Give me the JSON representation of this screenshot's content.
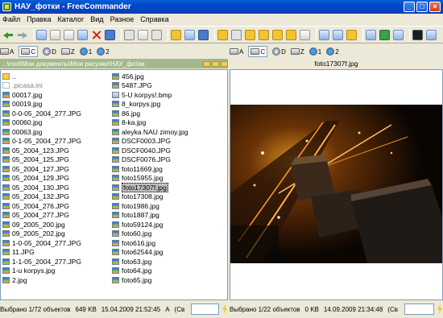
{
  "window": {
    "title": "НАУ_фотки - FreeCommander",
    "controls": [
      "_",
      "□",
      "×"
    ]
  },
  "menu": [
    "Файл",
    "Правка",
    "Каталог",
    "Вид",
    "Разное",
    "Справка"
  ],
  "drives_left": [
    {
      "label": "A",
      "type": "floppy"
    },
    {
      "label": "C",
      "type": "disk",
      "selected": true
    },
    {
      "label": "D",
      "type": "cd"
    },
    {
      "label": "Z",
      "type": "disk"
    },
    {
      "label": "1",
      "type": "net"
    },
    {
      "label": "2",
      "type": "net"
    }
  ],
  "drives_right": [
    {
      "label": "A",
      "type": "floppy"
    },
    {
      "label": "C",
      "type": "disk",
      "selected": true
    },
    {
      "label": "D",
      "type": "cd"
    },
    {
      "label": "Z",
      "type": "disk"
    },
    {
      "label": "1",
      "type": "net"
    },
    {
      "label": "2",
      "type": "net"
    }
  ],
  "left_path": "...\\root\\Мои документы\\Мои рисунки\\НАУ_фотки",
  "right_header": "foto17307f.jpg",
  "files_col1": [
    {
      "name": "..",
      "icon": "updir"
    },
    {
      "name": ".picasa.ini",
      "icon": "ini",
      "gray": true
    },
    {
      "name": "00017.jpg",
      "icon": "jpg"
    },
    {
      "name": "00019.jpg",
      "icon": "jpg"
    },
    {
      "name": "0-0-05_2004_277.JPG",
      "icon": "jpg"
    },
    {
      "name": "00060.jpg",
      "icon": "jpg"
    },
    {
      "name": "00063.jpg",
      "icon": "jpg"
    },
    {
      "name": "0-1-05_2004_277.JPG",
      "icon": "jpg"
    },
    {
      "name": "05_2004_123.JPG",
      "icon": "jpg"
    },
    {
      "name": "05_2004_125.JPG",
      "icon": "jpg"
    },
    {
      "name": "05_2004_127.JPG",
      "icon": "jpg"
    },
    {
      "name": "05_2004_129.JPG",
      "icon": "jpg"
    },
    {
      "name": "05_2004_130.JPG",
      "icon": "jpg"
    },
    {
      "name": "05_2004_132.JPG",
      "icon": "jpg"
    },
    {
      "name": "05_2004_276.JPG",
      "icon": "jpg"
    },
    {
      "name": "05_2004_277.JPG",
      "icon": "jpg"
    },
    {
      "name": "09_2005_200.jpg",
      "icon": "jpg"
    },
    {
      "name": "09_2005_202.jpg",
      "icon": "jpg"
    },
    {
      "name": "1-0-05_2004_277.JPG",
      "icon": "jpg"
    },
    {
      "name": "11.JPG",
      "icon": "jpg"
    },
    {
      "name": "1-1-05_2004_277.JPG",
      "icon": "jpg"
    },
    {
      "name": "1-u korpys.jpg",
      "icon": "jpg"
    },
    {
      "name": "2.jpg",
      "icon": "jpg"
    }
  ],
  "files_col2": [
    {
      "name": "456.jpg",
      "icon": "jpg"
    },
    {
      "name": "5487.JPG",
      "icon": "jpg"
    },
    {
      "name": "5-U korpys!.bmp",
      "icon": "bmp"
    },
    {
      "name": "8_korpys.jpg",
      "icon": "jpg"
    },
    {
      "name": "86.jpg",
      "icon": "jpg"
    },
    {
      "name": "8-ka.jpg",
      "icon": "jpg"
    },
    {
      "name": "aleyka NAU zimoy.jpg",
      "icon": "jpg"
    },
    {
      "name": "DSCF0003.JPG",
      "icon": "jpg"
    },
    {
      "name": "DSCF0040.JPG",
      "icon": "jpg"
    },
    {
      "name": "DSCF0076.JPG",
      "icon": "jpg"
    },
    {
      "name": "foto11669.jpg",
      "icon": "jpg"
    },
    {
      "name": "foto15955.jpg",
      "icon": "jpg"
    },
    {
      "name": "foto17307f.jpg",
      "icon": "jpg",
      "selected": true
    },
    {
      "name": "foto17308.jpg",
      "icon": "jpg"
    },
    {
      "name": "foto1986.jpg",
      "icon": "jpg"
    },
    {
      "name": "foto1887.jpg",
      "icon": "jpg"
    },
    {
      "name": "foto59124.jpg",
      "icon": "jpg"
    },
    {
      "name": "foto60.jpg",
      "icon": "jpg"
    },
    {
      "name": "foto616.jpg",
      "icon": "jpg"
    },
    {
      "name": "foto62544.jpg",
      "icon": "jpg"
    },
    {
      "name": "foto63.jpg",
      "icon": "jpg"
    },
    {
      "name": "foto64.jpg",
      "icon": "jpg"
    },
    {
      "name": "foto65.jpg",
      "icon": "jpg"
    }
  ],
  "status_left": {
    "selected": "Выбрано 1/72 объектов",
    "size": "649 KB",
    "date": "15.04.2009 21:52:45",
    "attr": "A",
    "extra": "(Сво"
  },
  "status_right": {
    "selected": "Выбрано 1/22 объектов",
    "size": "0 KB",
    "date": "14.09.2009 21:34:48",
    "extra": "(Сво"
  },
  "colors": {
    "titlebar": "#0A5FD8",
    "path_active": "#A3B98C",
    "background": "#ECE9D8"
  }
}
